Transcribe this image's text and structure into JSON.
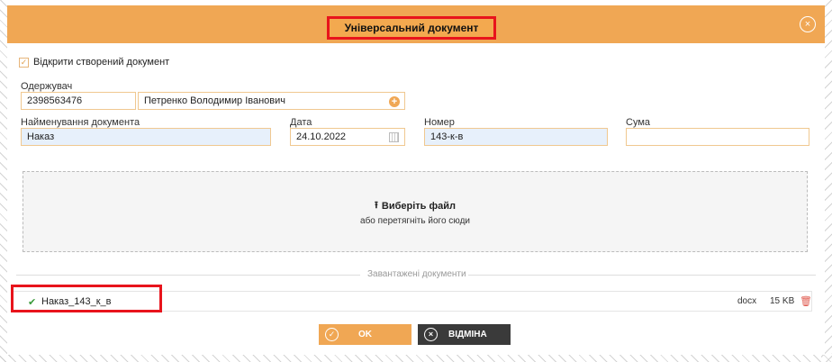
{
  "dialog": {
    "title": "Універсальний документ",
    "close_icon": "×"
  },
  "options": {
    "open_created_label": "Відкрити створений документ",
    "open_created_checked": true
  },
  "recipient": {
    "label": "Одержувач",
    "code": "2398563476",
    "name": "Петренко Володимир Іванович",
    "add_icon": "+"
  },
  "document": {
    "name_label": "Найменування документа",
    "name_value": "Наказ",
    "date_label": "Дата",
    "date_value": "24.10.2022",
    "number_label": "Номер",
    "number_value": "143-к-в",
    "sum_label": "Сума",
    "sum_value": ""
  },
  "dropzone": {
    "choose_label": "Виберіть файл",
    "hint": "або перетягніть його сюди",
    "upload_icon": "⭱"
  },
  "uploaded": {
    "divider_label": "Завантажені документи",
    "files": [
      {
        "check_icon": "✔",
        "name": "Наказ_143_к_в",
        "ext": "docx",
        "size": "15 KB",
        "trash_icon": "🗑"
      }
    ]
  },
  "buttons": {
    "ok_label": "OK",
    "ok_icon": "✓",
    "cancel_label": "ВІДМІНА",
    "cancel_icon": "×"
  },
  "colors": {
    "header": "#f0a754",
    "highlight": "#e8141c",
    "field_border": "#f0c890",
    "field_readonly_bg": "#e7f0fb",
    "cancel_bg": "#3a3a3a"
  }
}
